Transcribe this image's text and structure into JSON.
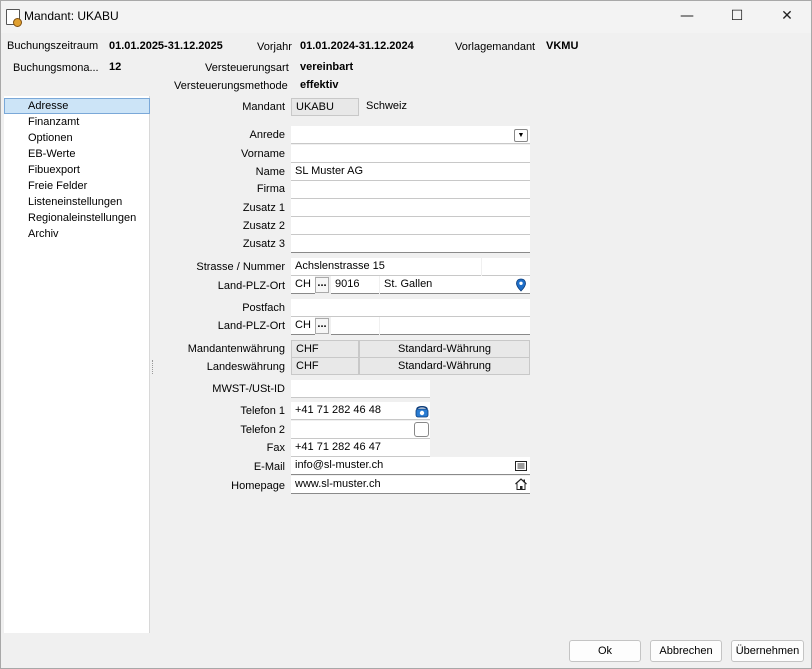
{
  "window": {
    "title": "Mandant: UKABU",
    "minimize_glyph": "—",
    "maximize_glyph": "☐",
    "close_glyph": "✕"
  },
  "header": {
    "buchungszeitraum_label": "Buchungszeitraum",
    "buchungszeitraum_value": "01.01.2025-31.12.2025",
    "vorjahr_label": "Vorjahr",
    "vorjahr_value": "01.01.2024-31.12.2024",
    "vorlagemandant_label": "Vorlagemandant",
    "vorlagemandant_value": "VKMU",
    "buchungsmonat_label": "Buchungsmona...",
    "buchungsmonat_value": "12",
    "versteuerungsart_label": "Versteuerungsart",
    "versteuerungsart_value": "vereinbart",
    "versteuerungsmethode_label": "Versteuerungsmethode",
    "versteuerungsmethode_value": "effektiv"
  },
  "nav": {
    "items": [
      {
        "label": "Adresse"
      },
      {
        "label": "Finanzamt"
      },
      {
        "label": "Optionen"
      },
      {
        "label": "EB-Werte"
      },
      {
        "label": "Fibuexport"
      },
      {
        "label": "Freie Felder"
      },
      {
        "label": "Listeneinstellungen"
      },
      {
        "label": "Regionaleinstellungen"
      },
      {
        "label": "Archiv"
      }
    ],
    "selected_index": 0
  },
  "form": {
    "mandant_label": "Mandant",
    "mandant_value": "UKABU",
    "mandant_country": "Schweiz",
    "anrede_label": "Anrede",
    "anrede_value": "",
    "vorname_label": "Vorname",
    "vorname_value": "",
    "name_label": "Name",
    "name_value": "SL Muster AG",
    "firma_label": "Firma",
    "firma_value": "",
    "zusatz1_label": "Zusatz 1",
    "zusatz1_value": "",
    "zusatz2_label": "Zusatz 2",
    "zusatz2_value": "",
    "zusatz3_label": "Zusatz 3",
    "zusatz3_value": "",
    "strasse_label": "Strasse / Nummer",
    "strasse_value": "Achslenstrasse 15",
    "hausnummer_value": "",
    "land_plz_ort_label": "Land-PLZ-Ort",
    "land_value": "CH",
    "plz_value": "9016",
    "ort_value": "St. Gallen",
    "postfach_label": "Postfach",
    "postfach_value": "",
    "land_plz_ort2_label": "Land-PLZ-Ort",
    "land2_value": "CH",
    "plz2_value": "",
    "ort2_value": "",
    "ellipsis": "...",
    "mandantenwaehrung_label": "Mandantenwährung",
    "mandantenwaehrung_code": "CHF",
    "mandantenwaehrung_desc": "Standard-Währung",
    "landeswaehrung_label": "Landeswährung",
    "landeswaehrung_code": "CHF",
    "landeswaehrung_desc": "Standard-Währung",
    "mwst_label": "MWST-/USt-ID",
    "mwst_value": "",
    "telefon1_label": "Telefon 1",
    "telefon1_value": "+41 71 282 46 48",
    "telefon2_label": "Telefon 2",
    "telefon2_value": "",
    "fax_label": "Fax",
    "fax_value": "+41 71 282 46 47",
    "email_label": "E-Mail",
    "email_value": "info@sl-muster.ch",
    "homepage_label": "Homepage",
    "homepage_value": "www.sl-muster.ch"
  },
  "icons": {
    "dropdown": "chevron-down-icon",
    "map_pin": "map-pin-icon",
    "phone": "phone-icon",
    "checkbox": "checkbox-icon",
    "email": "email-icon",
    "home": "home-icon"
  },
  "buttons": {
    "ok": "Ok",
    "cancel": "Abbrechen",
    "apply": "Übernehmen"
  },
  "colors": {
    "selection_bg": "#cce4f7",
    "selection_border": "#7aa8d8",
    "pin_blue": "#1e6ec8"
  }
}
